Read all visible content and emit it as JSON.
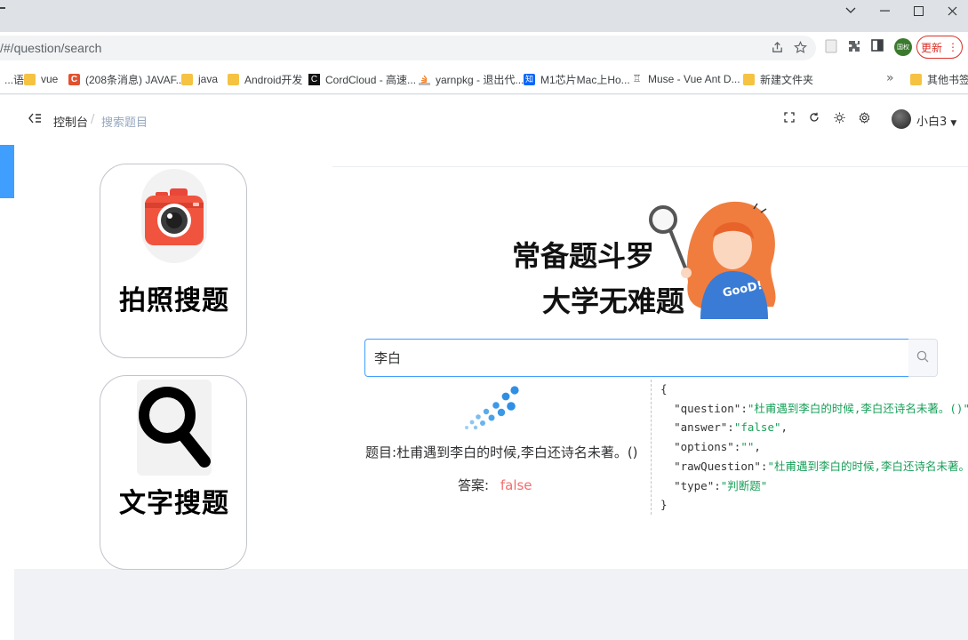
{
  "browser": {
    "url": "/#/question/search",
    "update_label": "更新",
    "profile_label": "国权",
    "bookmarks": [
      {
        "label": "...语",
        "icon": "folder-icon"
      },
      {
        "label": "vue",
        "icon": "folder-icon"
      },
      {
        "label": "(208条消息) JAVAF...",
        "icon": "csdn-icon"
      },
      {
        "label": "java",
        "icon": "folder-icon"
      },
      {
        "label": "Android开发",
        "icon": "folder-icon"
      },
      {
        "label": "CordCloud - 高速...",
        "icon": "cordcloud-icon"
      },
      {
        "label": "yarnpkg - 退出代...",
        "icon": "stackoverflow-icon"
      },
      {
        "label": "M1芯片Mac上Ho...",
        "icon": "zhihu-icon"
      },
      {
        "label": "Muse - Vue Ant D...",
        "icon": "muse-icon"
      },
      {
        "label": "新建文件夹",
        "icon": "folder-icon"
      }
    ],
    "other_bookmarks": "其他书签"
  },
  "header": {
    "breadcrumb": [
      "控制台",
      "/",
      "搜索题目"
    ],
    "username": "小白3"
  },
  "cards": [
    {
      "label": "拍照搜题",
      "icon": "camera-icon"
    },
    {
      "label": "文字搜题",
      "icon": "magnifier-icon"
    }
  ],
  "slogan": {
    "line1": "常备题斗罗",
    "line2": "大学无难题"
  },
  "search": {
    "value": "李白"
  },
  "result": {
    "title_label": "题目:",
    "title_text": "杜甫遇到李白的时候,李白还诗名未著。()",
    "answer_label": "答案:",
    "answer_value": "false"
  },
  "json_view": {
    "open": "{",
    "close": "}",
    "question_key": "\"question\"",
    "question_val": "\"杜甫遇到李白的时候,李白还诗名未著。()\"",
    "answer_key": "\"answer\"",
    "answer_val": "\"false\"",
    "options_key": "\"options\"",
    "options_val": "\"\"",
    "raw_key": "\"rawQuestion\"",
    "raw_val": "\"杜甫遇到李白的时候,李白还诗名未著。()\"",
    "type_key": "\"type\"",
    "type_val": "\"判断题\""
  },
  "colors": {
    "accent": "#409eff",
    "answer": "#f56c6c",
    "json_string": "#18a058"
  }
}
